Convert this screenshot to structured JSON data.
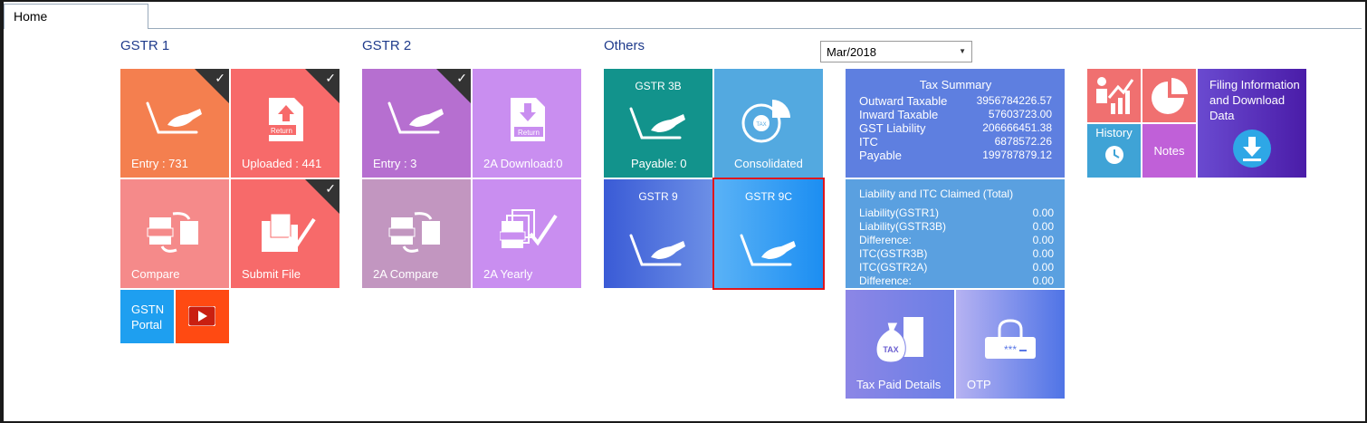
{
  "tab": {
    "label": "Home"
  },
  "sections": {
    "gstr1": "GSTR 1",
    "gstr2": "GSTR 2",
    "others": "Others"
  },
  "period": {
    "value": "Mar/2018"
  },
  "gstr1": {
    "entry": "Entry : 731",
    "uploaded": "Uploaded : 441",
    "compare": "Compare",
    "submit": "Submit File",
    "portal": "GSTN Portal"
  },
  "gstr2": {
    "entry": "Entry : 3",
    "download": "2A Download:0",
    "compare": "2A Compare",
    "yearly": "2A Yearly"
  },
  "others": {
    "gstr3b_title": "GSTR 3B",
    "gstr3b_payable": "Payable: 0",
    "consolidated": "Consolidated",
    "gstr9": "GSTR 9",
    "gstr9c": "GSTR 9C"
  },
  "return_badge": "Return",
  "tax_badge": "TAX",
  "otp_mask": "***",
  "tax_summary": {
    "title": "Tax Summary",
    "rows": [
      {
        "label": "Outward Taxable",
        "value": "3956784226.57"
      },
      {
        "label": "Inward Taxable",
        "value": "57603723.00"
      },
      {
        "label": "GST Liability",
        "value": "206666451.38"
      },
      {
        "label": "ITC",
        "value": "6878572.26"
      },
      {
        "label": "Payable",
        "value": "199787879.12"
      }
    ]
  },
  "liability": {
    "title": "Liability and ITC Claimed (Total)",
    "rows": [
      {
        "label": "Liability(GSTR1)",
        "value": "0.00"
      },
      {
        "label": "Liability(GSTR3B)",
        "value": "0.00"
      },
      {
        "label": "Difference:",
        "value": "0.00"
      },
      {
        "label": "ITC(GSTR3B)",
        "value": "0.00"
      },
      {
        "label": "ITC(GSTR2A)",
        "value": "0.00"
      },
      {
        "label": "Difference:",
        "value": "0.00"
      }
    ]
  },
  "tax_paid": "Tax Paid Details",
  "otp": "OTP",
  "right": {
    "history": "History",
    "notes": "Notes",
    "filing": "Filing Information and Download Data"
  },
  "colors": {
    "orange": "#f47f4f",
    "coral": "#f76a6a",
    "pink": "#f58a8a",
    "purple": "#b66fd0",
    "lavender": "#c98ef0",
    "mauve": "#c296c0",
    "teal": "#12938c",
    "skyblue": "#53a9e0",
    "royal": "#4a67d9",
    "summary": "#5e7fe0",
    "liability": "#5aa0e0",
    "selected_outline": "#e0161c"
  }
}
